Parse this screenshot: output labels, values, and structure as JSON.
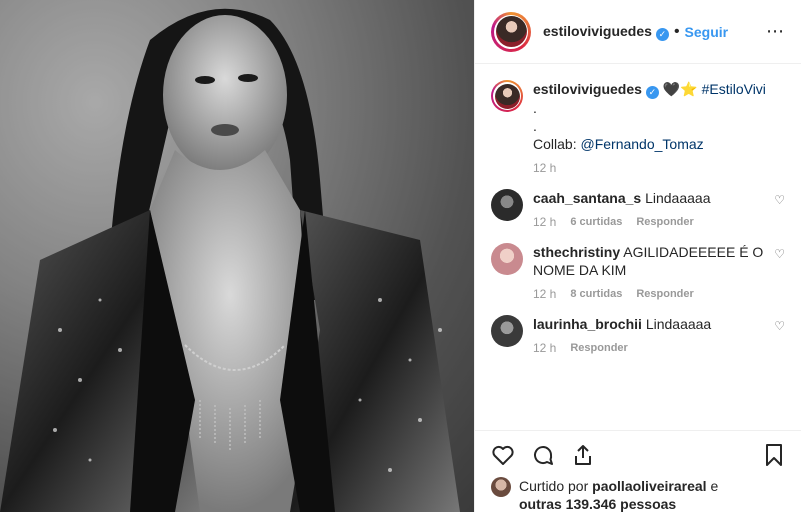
{
  "post": {
    "username": "estiloviviguedes",
    "verified": true,
    "follow_label": "Seguir",
    "more_icon": "more-icon",
    "separator": "•"
  },
  "caption": {
    "username": "estiloviviguedes",
    "emojis": "🖤⭐",
    "hashtag": "#EstiloVivi",
    "line2": ".",
    "line3": ".",
    "collab_label": "Collab:",
    "collab_handle": "@Fernando_Tomaz",
    "time": "12 h"
  },
  "comments": [
    {
      "username": "caah_santana_s",
      "text": "Lindaaaaa",
      "time": "12 h",
      "likes": "6 curtidas",
      "reply": "Responder",
      "avatar_color": "#2b2b2b"
    },
    {
      "username": "sthechristiny",
      "text": "AGILIDADEEEEE É O NOME DA KIM",
      "time": "12 h",
      "likes": "8 curtidas",
      "reply": "Responder",
      "avatar_color": "#c98a8f"
    },
    {
      "username": "laurinha_brochii",
      "text": "Lindaaaaa",
      "time": "12 h",
      "likes": "",
      "reply": "Responder",
      "avatar_color": "#3a3a3a"
    }
  ],
  "likes": {
    "prefix": "Curtido por",
    "liker": "paollaoliveirareal",
    "conj": "e",
    "others": "outras 139.346 pessoas"
  },
  "colors": {
    "accent": "#3897f0",
    "text": "#262626",
    "muted": "#999999",
    "border": "#efefef"
  }
}
